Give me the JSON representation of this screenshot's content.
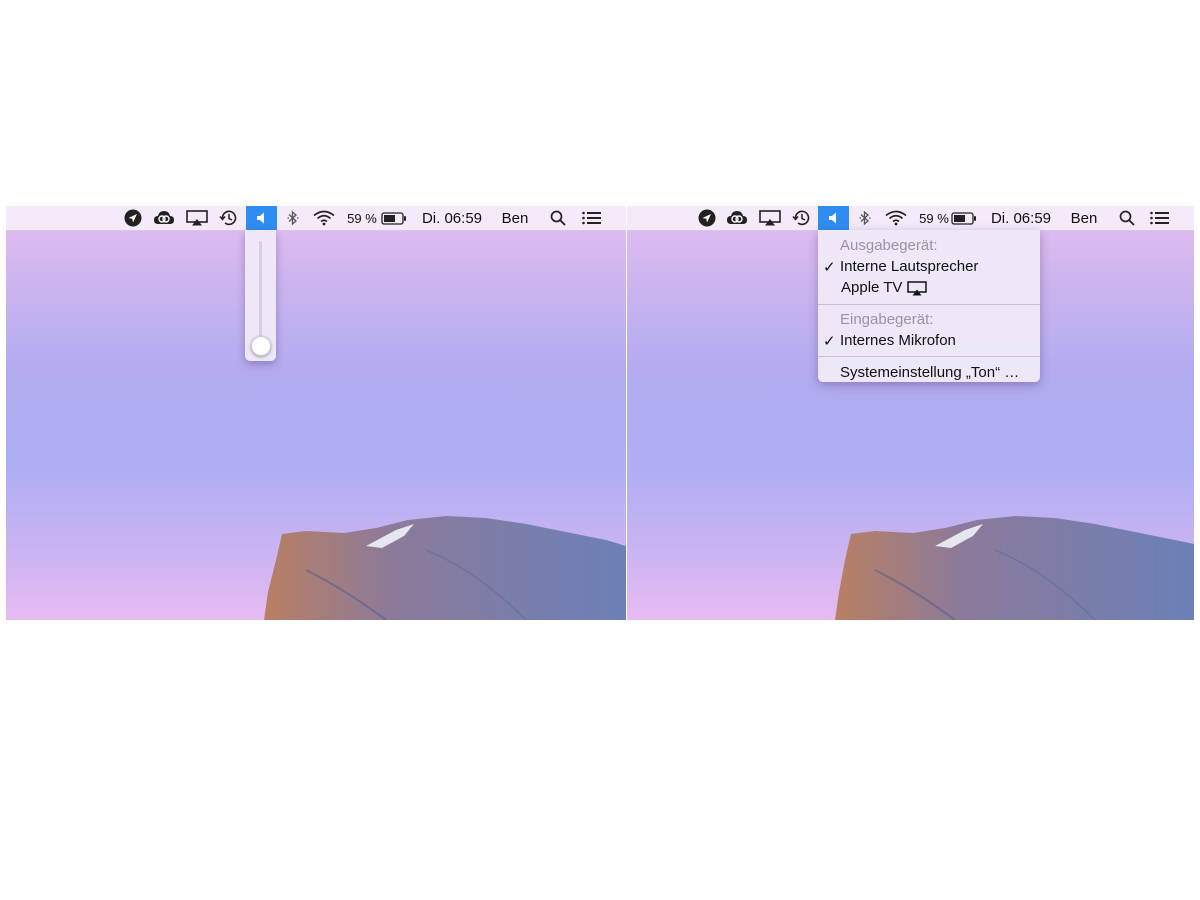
{
  "menubar": {
    "battery_percent": "59 %",
    "datetime": "Di. 06:59",
    "user": "Ben",
    "icons": [
      "location-arrow-icon",
      "creative-cloud-icon",
      "airplay-icon",
      "time-machine-icon",
      "volume-icon",
      "bluetooth-icon",
      "wifi-icon",
      "battery-icon",
      "spotlight-search-icon",
      "notification-center-icon"
    ]
  },
  "volume_slider": {
    "level": 0.0
  },
  "sound_menu": {
    "output_header": "Ausgabegerät:",
    "outputs": [
      {
        "label": "Interne Lautsprecher",
        "checked": true
      },
      {
        "label": "Apple TV",
        "checked": false,
        "icon": "airplay-icon"
      }
    ],
    "input_header": "Eingabegerät:",
    "inputs": [
      {
        "label": "Internes Mikrofon",
        "checked": true
      }
    ],
    "preferences": "Systemeinstellung „Ton“ …"
  },
  "colors": {
    "menubar_highlight": "#2f8cf0",
    "wallpaper_top": "#e4bdf0",
    "wallpaper_mid": "#adaef4"
  }
}
